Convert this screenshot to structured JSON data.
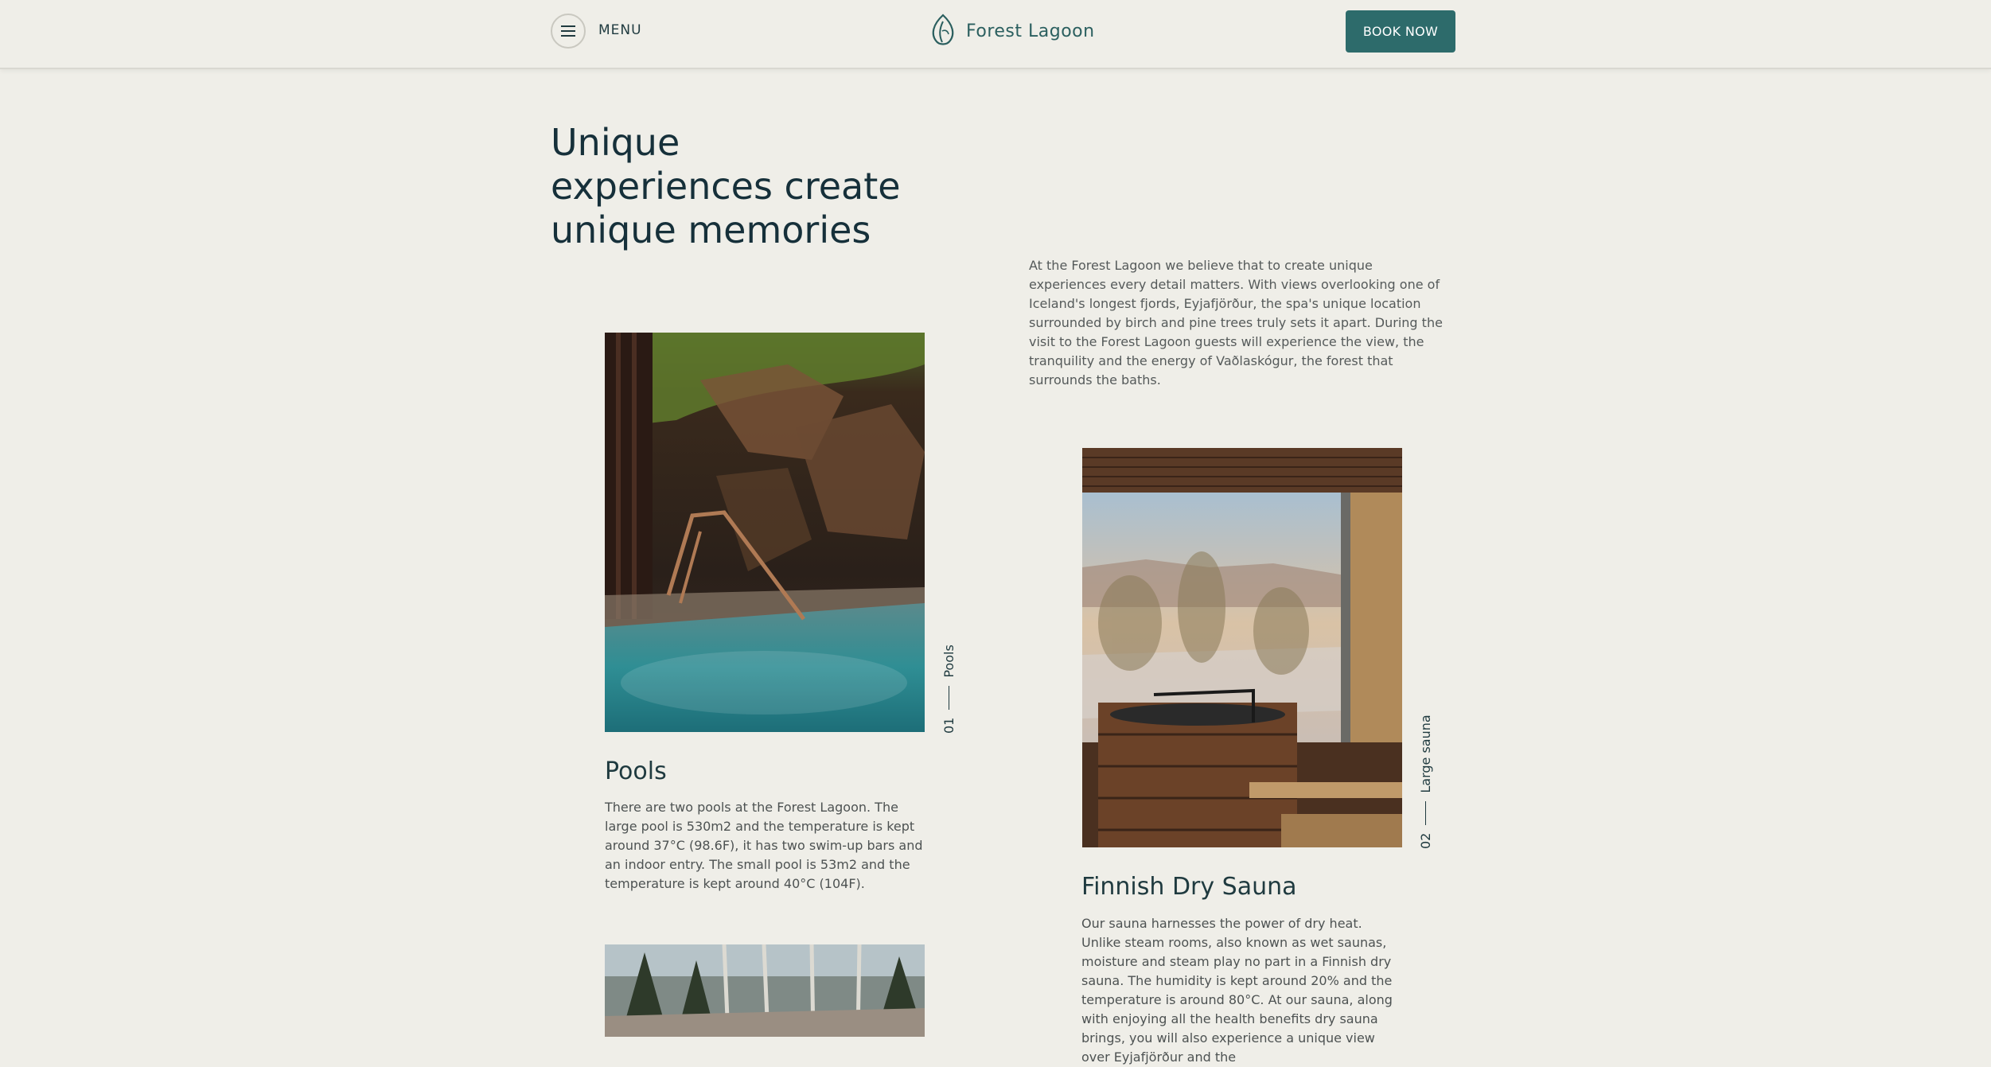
{
  "header": {
    "menu_label": "MENU",
    "logo_text": "Forest Lagoon",
    "book_label": "BOOK NOW"
  },
  "hero": {
    "headline_line1": "Unique",
    "headline_line2": "experiences create",
    "headline_line3": "unique memories",
    "intro": "At the Forest Lagoon we believe that to create unique experiences every detail matters. With views overlooking one of Iceland's longest fjords, Eyjafjörður, the spa's unique location surrounded by birch and pine trees truly sets it apart. During the visit to the Forest Lagoon guests will experience the view, the tranquility and the energy of Vaðlaskógur, the forest that surrounds the baths."
  },
  "cards": [
    {
      "number": "01",
      "label": "Pools",
      "title": "Pools",
      "text": "There are two pools at the Forest Lagoon. The large pool is 530m2 and the temperature is kept around 37°C (98.6F), it has two swim-up bars and an indoor entry. The small pool is 53m2 and the temperature is kept around 40°C (104F)."
    },
    {
      "number": "02",
      "label": "Large sauna",
      "title": "Finnish Dry Sauna",
      "text": "Our sauna harnesses the power of dry heat. Unlike steam rooms, also known as wet saunas, moisture and steam play no part in a Finnish dry sauna. The humidity is kept around 20% and the temperature is around 80°C. At our sauna, along with enjoying all the health benefits dry sauna brings, you will also experience a unique view over Eyjafjörður and the"
    }
  ],
  "colors": {
    "background": "#efeee8",
    "accent": "#2d6b6b",
    "heading": "#16303a"
  }
}
